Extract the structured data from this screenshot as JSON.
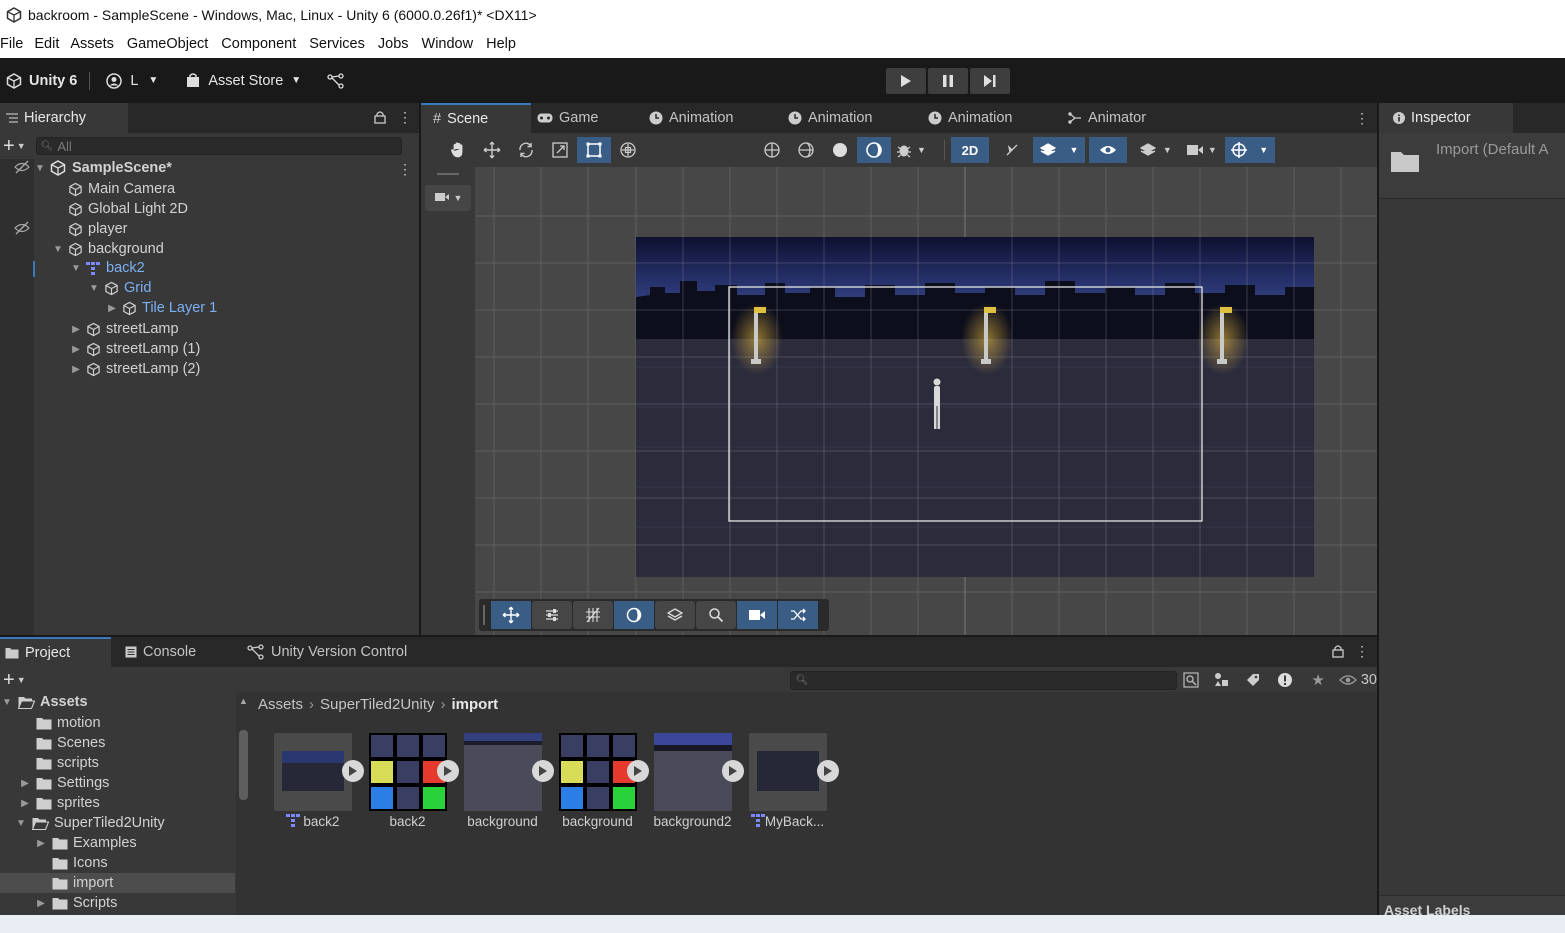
{
  "window": {
    "title": "backroom - SampleScene - Windows, Mac, Linux - Unity 6 (6000.0.26f1)* <DX11>"
  },
  "menu": [
    "File",
    "Edit",
    "Assets",
    "GameObject",
    "Component",
    "Services",
    "Jobs",
    "Window",
    "Help"
  ],
  "toolbar": {
    "unity_label": "Unity 6",
    "account_label": "L",
    "asset_store_label": "Asset Store"
  },
  "hierarchy": {
    "tab": "Hierarchy",
    "search_placeholder": "All",
    "scene": "SampleScene*",
    "items": [
      {
        "label": "Main Camera"
      },
      {
        "label": "Global Light 2D"
      },
      {
        "label": "player"
      },
      {
        "label": "background"
      },
      {
        "label": "back2"
      },
      {
        "label": "Grid"
      },
      {
        "label": "Tile Layer 1"
      },
      {
        "label": "streetLamp"
      },
      {
        "label": "streetLamp (1)"
      },
      {
        "label": "streetLamp (2)"
      }
    ]
  },
  "center_tabs": [
    "Scene",
    "Game",
    "Animation",
    "Animation",
    "Animation",
    "Animator"
  ],
  "scene_toolbar": {
    "mode_2d": "2D"
  },
  "inspector": {
    "tab": "Inspector",
    "header": "Import (Default A",
    "footer": "Asset Labels"
  },
  "bottom_tabs": [
    "Project",
    "Console",
    "Unity Version Control"
  ],
  "project": {
    "hidden_count": "30",
    "tree": [
      {
        "label": "Assets"
      },
      {
        "label": "motion"
      },
      {
        "label": "Scenes"
      },
      {
        "label": "scripts"
      },
      {
        "label": "Settings"
      },
      {
        "label": "sprites"
      },
      {
        "label": "SuperTiled2Unity"
      },
      {
        "label": "Examples"
      },
      {
        "label": "Icons"
      },
      {
        "label": "import"
      },
      {
        "label": "Scripts"
      }
    ],
    "breadcrumb": [
      "Assets",
      "SuperTiled2Unity",
      "import"
    ],
    "assets": [
      {
        "label": "back2"
      },
      {
        "label": "back2"
      },
      {
        "label": "background"
      },
      {
        "label": "background"
      },
      {
        "label": "background2"
      },
      {
        "label": "MyBack..."
      }
    ]
  },
  "colors": {
    "accent": "#3a79bb",
    "selected_text": "#7cb0f4",
    "panel": "#383838",
    "dark": "#282828"
  }
}
